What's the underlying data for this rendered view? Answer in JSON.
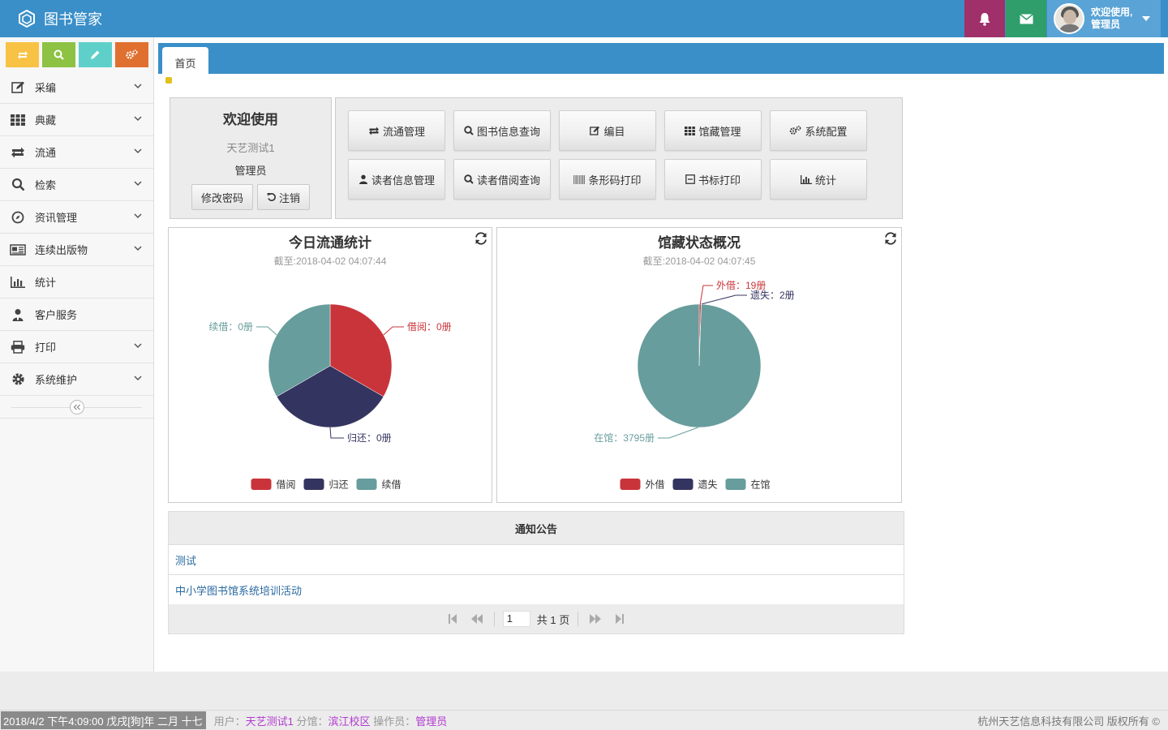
{
  "app": {
    "title": "图书管家"
  },
  "header": {
    "welcome": "欢迎使用,",
    "role": "管理员"
  },
  "sidebar": {
    "items": [
      {
        "label": "采编",
        "icon": "edit-icon",
        "expandable": true
      },
      {
        "label": "典藏",
        "icon": "grid-icon",
        "expandable": true
      },
      {
        "label": "流通",
        "icon": "circulation-icon",
        "expandable": true
      },
      {
        "label": "检索",
        "icon": "search-icon",
        "expandable": true
      },
      {
        "label": "资讯管理",
        "icon": "compass-icon",
        "expandable": true
      },
      {
        "label": "连续出版物",
        "icon": "newspaper-icon",
        "expandable": true
      },
      {
        "label": "统计",
        "icon": "bar-chart-icon",
        "expandable": false
      },
      {
        "label": "客户服务",
        "icon": "user-service-icon",
        "expandable": false
      },
      {
        "label": "打印",
        "icon": "printer-icon",
        "expandable": true
      },
      {
        "label": "系统维护",
        "icon": "gear-icon",
        "expandable": true
      }
    ]
  },
  "tabs": {
    "home": "首页"
  },
  "welcome": {
    "title": "欢迎使用",
    "library": "天艺测试1",
    "role": "管理员",
    "change_password": "修改密码",
    "logout": "注销"
  },
  "quick": {
    "buttons": [
      "流通管理",
      "图书信息查询",
      "编目",
      "馆藏管理",
      "系统配置",
      "读者信息管理",
      "读者借阅查询",
      "条形码打印",
      "书标打印",
      "统计"
    ]
  },
  "chart_data": [
    {
      "type": "pie",
      "title": "今日流通统计",
      "subtitle": "截至:2018-04-02 04:07:44",
      "categories": [
        "借阅",
        "归还",
        "续借"
      ],
      "values": [
        0,
        0,
        0
      ],
      "labels": [
        "借阅：0册",
        "归还：0册",
        "续借：0册"
      ],
      "colors": [
        "#c9343a",
        "#343460",
        "#679d9c"
      ],
      "legend": "bottom"
    },
    {
      "type": "pie",
      "title": "馆藏状态概况",
      "subtitle": "截至:2018-04-02 04:07:45",
      "categories": [
        "外借",
        "遗失",
        "在馆"
      ],
      "values": [
        19,
        2,
        3795
      ],
      "labels": [
        "外借：19册",
        "遗失：2册",
        "在馆：3795册"
      ],
      "colors": [
        "#c9343a",
        "#343460",
        "#679d9c"
      ],
      "legend": "bottom"
    }
  ],
  "notice": {
    "title": "通知公告",
    "items": [
      "测试",
      "中小学图书馆系统培训活动"
    ],
    "page": "1",
    "total": "共 1 页"
  },
  "status": {
    "clock": "2018/4/2 下午4:09:00 戊戌[狗]年 二月 十七",
    "user_label": "用户：",
    "user": "天艺测试1",
    "branch_label": "分馆：",
    "branch": "滨江校区",
    "operator_label": "操作员：",
    "operator": "管理员",
    "copyright": "杭州天艺信息科技有限公司 版权所有 ©"
  }
}
